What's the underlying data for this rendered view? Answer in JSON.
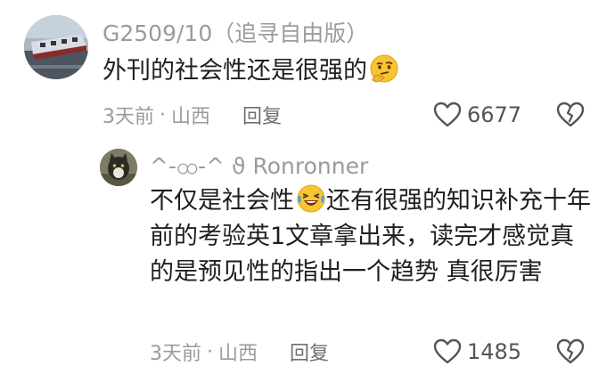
{
  "main_comment": {
    "username": "G2509/10（追寻自由版）",
    "text": "外刊的社会性还是很强的",
    "time": "3天前",
    "separator": "·",
    "location": "山西",
    "reply_label": "回复",
    "likes": "6677",
    "emoji": "thinking-face-emoji",
    "avatar": "train-photo-avatar"
  },
  "reply_comment": {
    "username": "^-ထ-^ ϑ Ronronner",
    "text_part1": "不仅是社会性",
    "text_part2": "还有很强的知识补充十年前的考验英1文章拿出来，读完才感觉真的是预见性的指出一个趋势 真很厉害",
    "time": "3天前",
    "separator": "·",
    "location": "山西",
    "reply_label": "回复",
    "likes": "1485",
    "emoji": "laughing-crying-face-emoji",
    "avatar": "cat-photo-avatar"
  },
  "icons": {
    "like": "heart-outline-icon",
    "dislike": "broken-heart-outline-icon"
  },
  "colors": {
    "meta_text": "#9b9b9b",
    "body_text": "#1f1f1f"
  }
}
